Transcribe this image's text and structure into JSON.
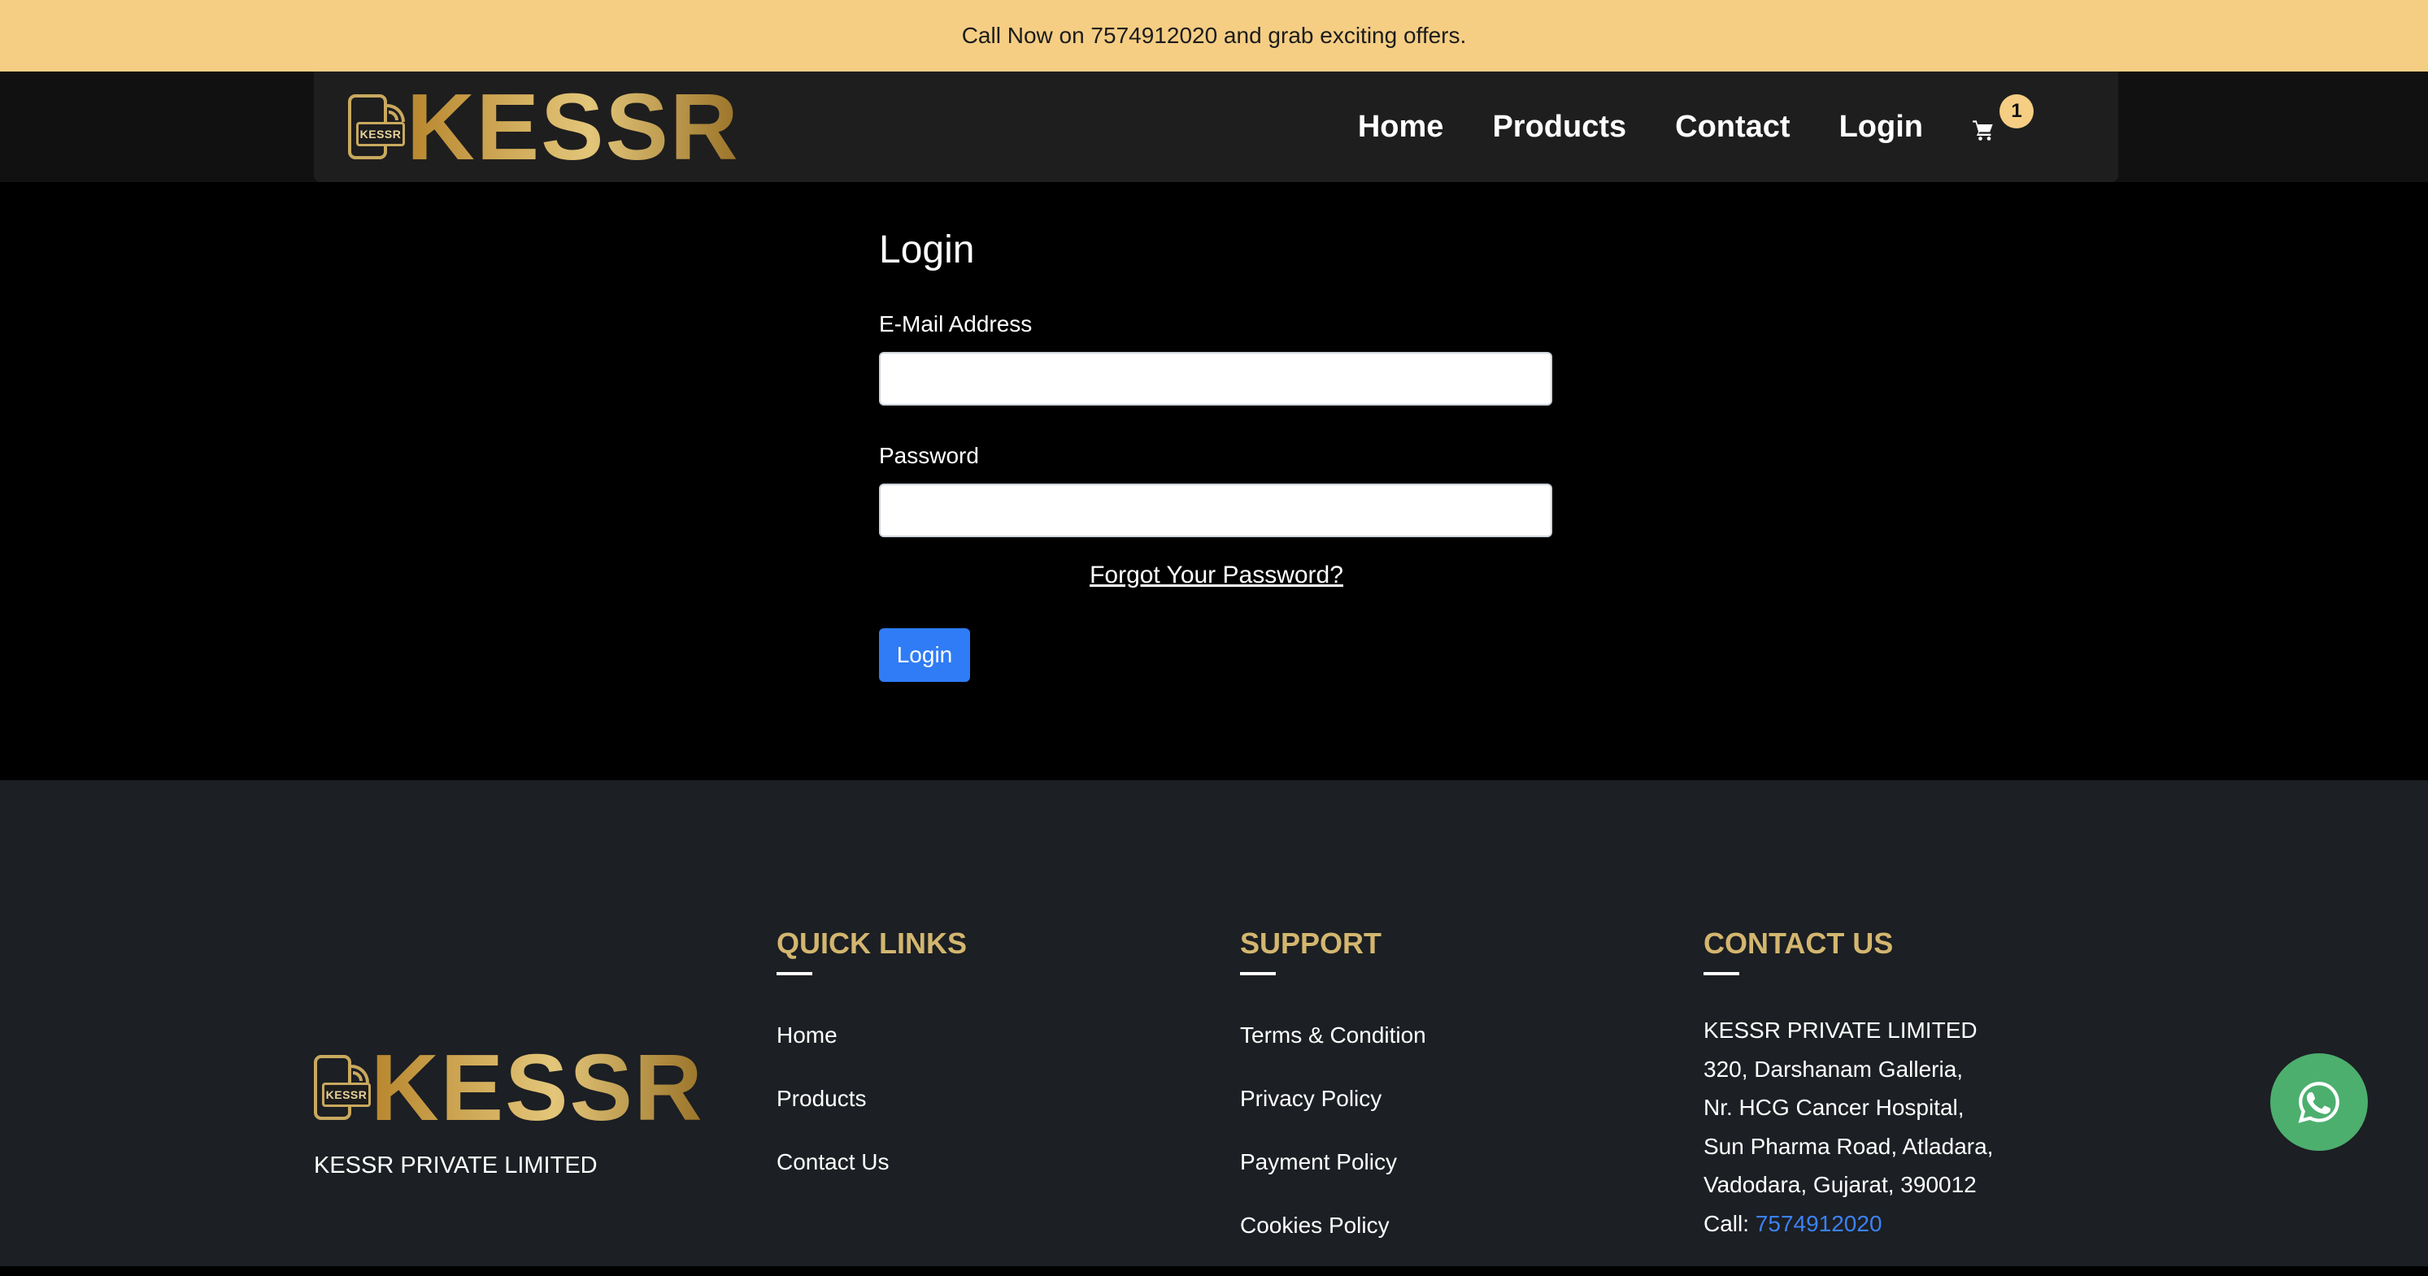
{
  "topbar": {
    "text": "Call Now on 7574912020 and grab exciting offers."
  },
  "brand": {
    "name": "KESSR",
    "chip": "KESSR"
  },
  "nav": {
    "links": [
      "Home",
      "Products",
      "Contact",
      "Login"
    ],
    "cart_count": "1"
  },
  "login": {
    "title": "Login",
    "email_label": "E-Mail Address",
    "email_value": "",
    "password_label": "Password",
    "password_value": "",
    "forgot": "Forgot Your Password?",
    "submit": "Login"
  },
  "footer": {
    "company": "KESSR PRIVATE LIMITED",
    "quick_links": {
      "title": "QUICK LINKS",
      "items": [
        "Home",
        "Products",
        "Contact Us"
      ]
    },
    "support": {
      "title": "SUPPORT",
      "items": [
        "Terms & Condition",
        "Privacy Policy",
        "Payment Policy",
        "Cookies Policy"
      ]
    },
    "contact": {
      "title": "CONTACT US",
      "lines": [
        "KESSR PRIVATE LIMITED",
        "320, Darshanam Galleria,",
        "Nr. HCG Cancer Hospital,",
        "Sun Pharma Road, Atladara,",
        "Vadodara, Gujarat, 390012"
      ],
      "call_label": "Call:",
      "phone": "7574912020"
    }
  },
  "colors": {
    "topbar": "#f5ce84",
    "gold": "#d3b66f",
    "button": "#2f7cf6",
    "whatsapp": "#4caf6e",
    "footer": "#1c1f23"
  },
  "icons": {
    "cart": "cart-icon",
    "whatsapp": "whatsapp-icon"
  }
}
